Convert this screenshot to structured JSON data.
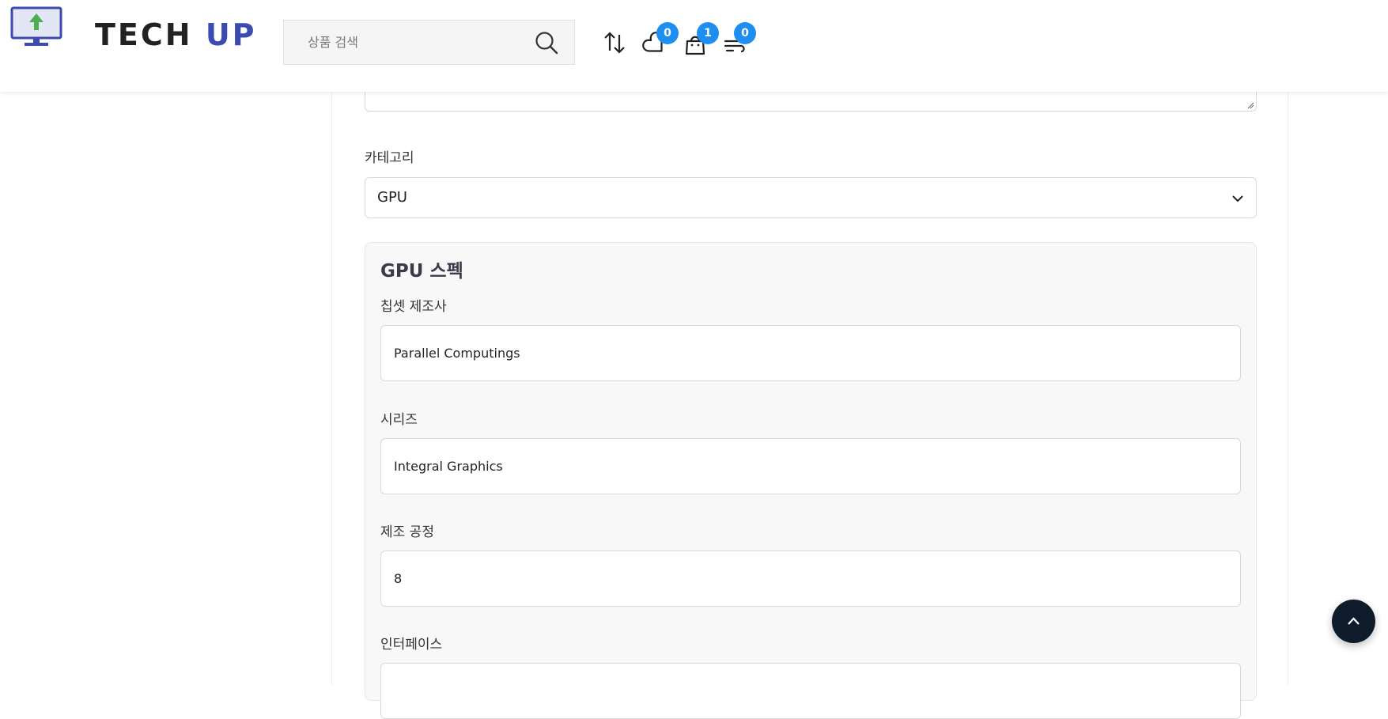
{
  "header": {
    "logo_tech": "TECH",
    "logo_up": "UP",
    "search": {
      "placeholder": "상품 검색",
      "value": ""
    },
    "icons": {
      "compare": "arrows-up-down-icon",
      "wishlist": "heart-icon",
      "cart": "shopping-bag-icon",
      "recent": "wind-icon"
    },
    "badges": {
      "wishlist_count": "0",
      "cart_count": "1",
      "recent_count": "0"
    }
  },
  "form": {
    "category_label": "카테고리",
    "category_value": "GPU",
    "spec_title": "GPU 스펙",
    "fields": [
      {
        "label": "칩셋 제조사",
        "value": "Parallel Computings"
      },
      {
        "label": "시리즈",
        "value": "Integral Graphics"
      },
      {
        "label": "제조 공정",
        "value": "8"
      },
      {
        "label": "인터페이스",
        "value": ""
      }
    ]
  },
  "colors": {
    "brand_blue": "#3b4bb0",
    "badge_blue": "#1f8ef1",
    "scroll_top_bg": "#0d1b2a",
    "logo_arrow_green": "#4caf50"
  }
}
